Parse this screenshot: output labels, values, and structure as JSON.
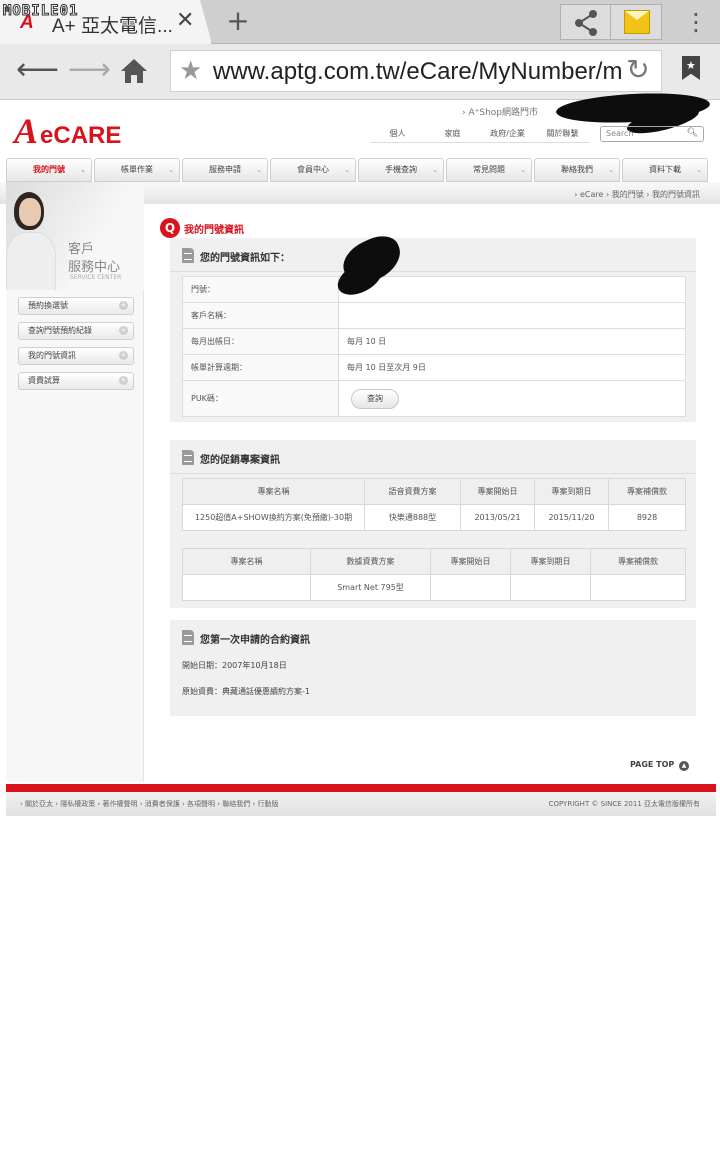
{
  "watermark": "MOBILE01",
  "tab": {
    "favicon": "A",
    "title": "A+ 亞太電信...",
    "close": "✕",
    "new_tab": "+"
  },
  "browser": {
    "url": "www.aptg.com.tw/eCare/MyNumber/myN",
    "icons": [
      "share-icon",
      "mail-icon",
      "overflow-menu-icon",
      "back-icon",
      "forward-icon",
      "home-icon",
      "star-icon",
      "reload-icon",
      "bookmark-icon"
    ]
  },
  "header": {
    "logo_a": "A",
    "logo_text": "eCARE",
    "shop_link": "› A⁺Shop網路門市",
    "top_links": [
      "個人",
      "家庭",
      "政府/企業",
      "關於聯繫"
    ],
    "search_placeholder": "Search"
  },
  "nav": {
    "items": [
      "我的門號",
      "帳單作業",
      "服務申請",
      "會員中心",
      "手機查詢",
      "常見問題",
      "聯絡我們",
      "資料下載"
    ],
    "active": "我的門號"
  },
  "breadcrumb": "› eCare › 我的門號 › 我的門號資訊",
  "sidebar": {
    "banner_line1": "客戶",
    "banner_line2": "服務中心",
    "banner_sub": "SERVICE CENTER",
    "items": [
      "預約換選號",
      "查詢門號預約紀錄",
      "我的門號資訊",
      "資費試算"
    ]
  },
  "page_title": "我的門號資訊",
  "number_info": {
    "title": "您的門號資訊如下：",
    "rows": [
      {
        "label": "門號：",
        "value": ""
      },
      {
        "label": "客戶名稱：",
        "value": ""
      },
      {
        "label": "每月出帳日：",
        "value": "每月 10 日"
      },
      {
        "label": "帳單計算週期：",
        "value": "每月 10 日至次月 9日"
      },
      {
        "label": "PUK碼：",
        "value": ""
      }
    ],
    "puk_button": "查詢"
  },
  "promo": {
    "title": "您的促銷專案資訊",
    "voice": {
      "headers": [
        "專案名稱",
        "語音資費方案",
        "專案開始日",
        "專案到期日",
        "專案補償款"
      ],
      "rows": [
        [
          "1250超值A+SHOW換約方案(免預繳)-30期",
          "快樂通888型",
          "2013/05/21",
          "2015/11/20",
          "8928"
        ]
      ]
    },
    "data": {
      "headers": [
        "專案名稱",
        "數據資費方案",
        "專案開始日",
        "專案到期日",
        "專案補償款"
      ],
      "rows": [
        [
          "",
          "Smart Net 795型",
          "",
          "",
          ""
        ]
      ]
    }
  },
  "contract": {
    "title": "您第一次申請的合約資訊",
    "start_date": "開始日期：2007年10月18日",
    "original_plan": "原始資費：典藏通話優惠續約方案-1"
  },
  "page_top": "PAGE TOP",
  "footer": {
    "links": "› 關於亞太 › 隱私權政策 › 著作權聲明 › 消費者保護 › 各項聲明 › 聯絡我們 › 行動版",
    "copyright": "COPYRIGHT © SINCE 2011 亞太電信版權所有"
  }
}
